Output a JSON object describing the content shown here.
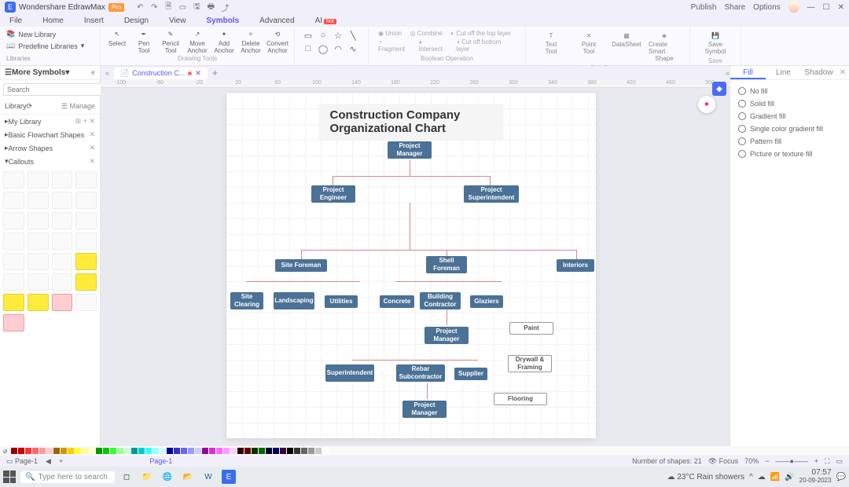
{
  "app": {
    "name": "Wondershare EdrawMax",
    "badge": "Pro"
  },
  "titlebar_right": {
    "publish": "Publish",
    "share": "Share",
    "options": "Options"
  },
  "menu": [
    "File",
    "Home",
    "Insert",
    "Design",
    "View",
    "Symbols",
    "Advanced",
    "AI"
  ],
  "menu_active": "Symbols",
  "ribbon_left": {
    "new_lib": "New Library",
    "predef": "Predefine Libraries",
    "label": "Libraries"
  },
  "tools": {
    "select": "Select",
    "pen": {
      "l1": "Pen",
      "l2": "Tool"
    },
    "pencil": {
      "l1": "Pencil",
      "l2": "Tool"
    },
    "move": {
      "l1": "Move",
      "l2": "Anchor"
    },
    "add": {
      "l1": "Add",
      "l2": "Anchor"
    },
    "delete": {
      "l1": "Delete",
      "l2": "Anchor"
    },
    "convert": {
      "l1": "Convert",
      "l2": "Anchor"
    },
    "group_label": "Drawing Tools"
  },
  "bool": {
    "union": "Union",
    "combine": "Combine",
    "cut_top": "Cut off the top layer",
    "fragment": "Fragment",
    "intersect": "Intersect",
    "cut_bottom": "Cut off bottom layer",
    "label": "Boolean Operation"
  },
  "rtools": {
    "text": {
      "l1": "Text",
      "l2": "Tool"
    },
    "point": {
      "l1": "Point",
      "l2": "Tool"
    },
    "datasheet": "DataSheet",
    "smart": {
      "l1": "Create Smart",
      "l2": "Shape"
    },
    "save": {
      "l1": "Save",
      "l2": "Symbol"
    },
    "label1": "Edit Shapes",
    "label2": "Save"
  },
  "left": {
    "more": "More Symbols",
    "search_btn": "Search",
    "search_ph": "Search",
    "lib": "Library",
    "manage": "Manage",
    "mylib": "My Library",
    "cats": [
      "Basic Flowchart Shapes",
      "Arrow Shapes",
      "Callouts"
    ]
  },
  "tab": {
    "name": "Construction C..."
  },
  "chart": {
    "title": "Construction Company Organizational Chart",
    "nodes": {
      "pm1": "Project\nManager",
      "eng": "Project\nEngineer",
      "sup": "Project\nSuperintendent",
      "site": "Site Foreman",
      "shell": "Shell\nForeman",
      "int": "Interiors",
      "sc": "Site\nClearing",
      "land": "Landscaping",
      "util": "Utilities",
      "conc": "Concrete",
      "bld": "Building\nContractor",
      "glaz": "Glaziers",
      "pm2": "Project\nManager",
      "paint": "Paint",
      "supnt": "Superintendent",
      "rebar": "Rebar\nSubcontractor",
      "supp": "Supplier",
      "dry": "Drywall &\nFraming",
      "pm3": "Project\nManager",
      "floor": "Flooring"
    }
  },
  "right": {
    "tabs": [
      "Fill",
      "Line",
      "Shadow"
    ],
    "opts": [
      "No fill",
      "Solid fill",
      "Gradient fill",
      "Single color gradient fill",
      "Pattern fill",
      "Picture or texture fill"
    ]
  },
  "status": {
    "page": "Page-1",
    "page2": "Page-1",
    "shapes": "Number of shapes: 21",
    "focus": "Focus",
    "zoom": "70%"
  },
  "taskbar": {
    "search": "Type here to search",
    "weather": "23°C  Rain showers",
    "time": "07:57",
    "date": "20-09-2023"
  }
}
